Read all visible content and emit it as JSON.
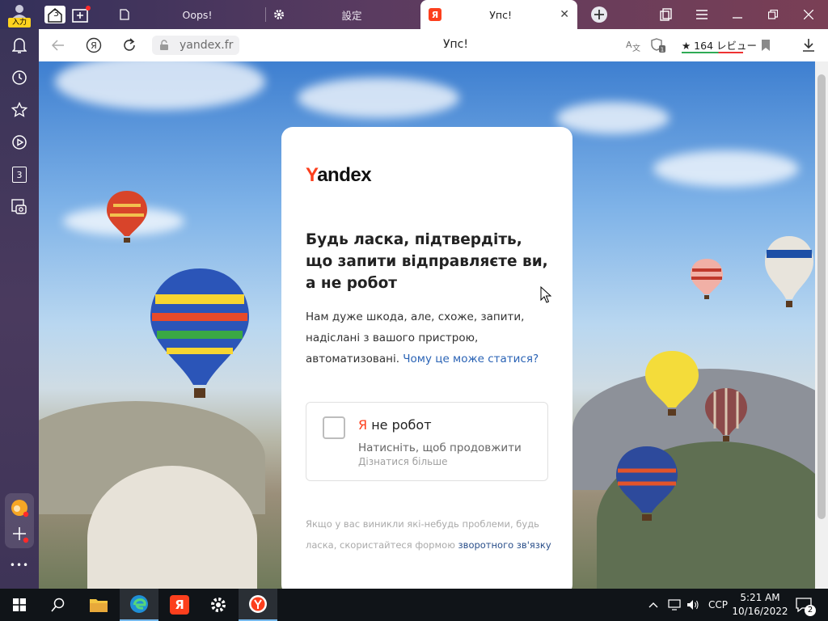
{
  "browser": {
    "profile_badge": "入力",
    "tab_count": "3",
    "tabs": [
      {
        "title": "Oops!",
        "active": false
      },
      {
        "title": "設定",
        "active": false
      },
      {
        "title": "Упс!",
        "active": true
      }
    ],
    "address": {
      "url": "yandex.fr",
      "page_title": "Упс!",
      "reviews_label": "★ 164 レビュー"
    },
    "sidebar": {
      "collections_count": "3",
      "more_label": "•••"
    }
  },
  "captcha": {
    "logo_first": "Y",
    "logo_rest": "andex",
    "heading": "Будь ласка, підтвердіть, що запити відправляєте ви, а не робот",
    "description_line1": "Нам дуже шкода, але, схоже, запити,",
    "description_line2": "надіслані з вашого пристрою,",
    "description_line3": "автоматизовані.",
    "why_link": "Чому це може статися?",
    "robot_ya": "Я",
    "robot_label": " не робот",
    "robot_hint": "Натисніть, щоб продовжити",
    "robot_more": "Дізнатися більше",
    "footer_text_1": "Якщо у вас виникли які-небудь проблеми, будь",
    "footer_text_2": "ласка, скористайтеся формою",
    "footer_link": "зворотного зв'язку"
  },
  "taskbar": {
    "language": "CCP",
    "time": "5:21 AM",
    "date": "10/16/2022",
    "notifications": "2"
  },
  "colors": {
    "yandex_red": "#fc3f1d",
    "link_blue": "#2a63b5",
    "taskbar_bg": "#101418"
  }
}
